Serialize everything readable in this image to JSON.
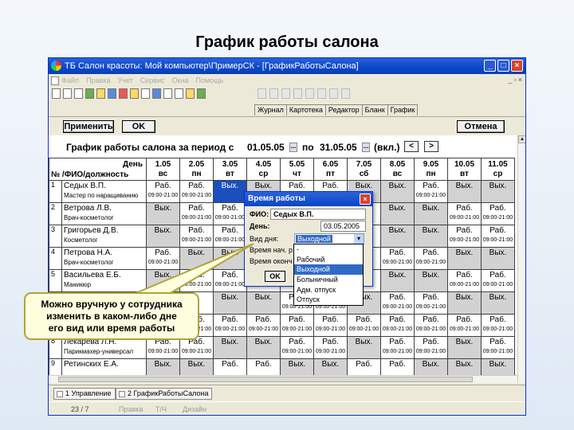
{
  "slide_title": "График работы салона",
  "window": {
    "title": "ТБ Салон красоты: Мой компьютер\\ПримерСК - [ГрафикРаботыСалона]",
    "min": "_",
    "max": "□",
    "close": "×"
  },
  "menu": [
    "Файл",
    "Правка",
    "Учет",
    "Сервис",
    "Окна",
    "Помощь"
  ],
  "tabs": [
    "Журнал",
    "Картотека",
    "Редактор",
    "Бланк",
    "График"
  ],
  "buttons": {
    "apply": "Применить",
    "ok": "OK",
    "cancel": "Отмена"
  },
  "period": {
    "label": "График работы салона за период с",
    "from": "01.05.05",
    "to_label": "по",
    "to": "31.05.05",
    "incl": "(вкл.)",
    "pick": "...",
    "prev": "<",
    "next": ">"
  },
  "grid_header": {
    "day_label": "День",
    "name_label": "№ /ФИО/должность"
  },
  "days": [
    {
      "d": "1.05",
      "w": "вс"
    },
    {
      "d": "2.05",
      "w": "пн"
    },
    {
      "d": "3.05",
      "w": "вт"
    },
    {
      "d": "4.05",
      "w": "ср"
    },
    {
      "d": "5.05",
      "w": "чт"
    },
    {
      "d": "6.05",
      "w": "пт"
    },
    {
      "d": "7.05",
      "w": "сб"
    },
    {
      "d": "8.05",
      "w": "вс"
    },
    {
      "d": "9.05",
      "w": "пн"
    },
    {
      "d": "10.05",
      "w": "вт"
    },
    {
      "d": "11.05",
      "w": "ср"
    }
  ],
  "employees": [
    {
      "n": "1",
      "name": "Седых В.П.",
      "pos": "Мастер по наращиванию",
      "cells": [
        {
          "s": "Раб.",
          "t": "09:00-21:00"
        },
        {
          "s": "Раб.",
          "t": "09:00-21:00"
        },
        {
          "s": "Вых.",
          "sel": true
        },
        {
          "s": "Вых."
        },
        {
          "s": "Раб."
        },
        {
          "s": "Раб."
        },
        {
          "s": "Вых."
        },
        {
          "s": "Вых."
        },
        {
          "s": "Раб.",
          "t": "09:00-21:00"
        },
        {
          "s": "Вых."
        },
        {
          "s": "Вых."
        }
      ]
    },
    {
      "n": "2",
      "name": "Ветрова Л.В.",
      "pos": "Врач-косметолог",
      "cells": [
        {
          "s": "Вых."
        },
        {
          "s": "Раб.",
          "t": "09:00-21:00"
        },
        {
          "s": "Раб.",
          "t": "09:00-21:00"
        },
        {
          "s": ""
        },
        {
          "s": ""
        },
        {
          "s": ""
        },
        {
          "s": ""
        },
        {
          "s": "Вых."
        },
        {
          "s": "Вых."
        },
        {
          "s": "Раб.",
          "t": "09:00-21:00"
        },
        {
          "s": "Раб.",
          "t": "09:00-21:00"
        }
      ]
    },
    {
      "n": "3",
      "name": "Григорьев Д.В.",
      "pos": "Косметолог",
      "cells": [
        {
          "s": "Вых."
        },
        {
          "s": "Раб.",
          "t": "09:00-21:00"
        },
        {
          "s": "Раб.",
          "t": "09:00-21:00"
        },
        {
          "s": ""
        },
        {
          "s": ""
        },
        {
          "s": ""
        },
        {
          "s": ""
        },
        {
          "s": "Вых."
        },
        {
          "s": "Вых."
        },
        {
          "s": "Раб.",
          "t": "09:00-21:00"
        },
        {
          "s": "Раб.",
          "t": "09:00-21:00"
        }
      ]
    },
    {
      "n": "4",
      "name": "Петрова Н.А.",
      "pos": "Врач-косметолог",
      "cells": [
        {
          "s": "Раб.",
          "t": "09:00-21:00"
        },
        {
          "s": "Вых."
        },
        {
          "s": "Вых."
        },
        {
          "s": ""
        },
        {
          "s": ""
        },
        {
          "s": ""
        },
        {
          "s": ""
        },
        {
          "s": "Раб.",
          "t": "09:00-21:00"
        },
        {
          "s": "Раб.",
          "t": "09:00-21:00"
        },
        {
          "s": "Вых."
        },
        {
          "s": "Вых."
        }
      ]
    },
    {
      "n": "5",
      "name": "Васильева Е.Б.",
      "pos": "Маникюр",
      "cells": [
        {
          "s": "Вых."
        },
        {
          "s": "Раб.",
          "t": "09:00-21:00"
        },
        {
          "s": "Раб.",
          "t": "09:00-21:00"
        },
        {
          "s": ""
        },
        {
          "s": ""
        },
        {
          "s": ""
        },
        {
          "s": ""
        },
        {
          "s": "Вых."
        },
        {
          "s": "Вых."
        },
        {
          "s": "Раб.",
          "t": "09:00-21:00"
        },
        {
          "s": "Раб.",
          "t": "09:00-21:00"
        }
      ]
    },
    {
      "n": "6",
      "name": "",
      "pos": "",
      "cells": [
        {
          "s": ""
        },
        {
          "s": ""
        },
        {
          "s": "Вых."
        },
        {
          "s": "Вых."
        },
        {
          "s": "Раб.",
          "t": "09:00-21:00"
        },
        {
          "s": "Раб.",
          "t": "09:00-21:00"
        },
        {
          "s": "Вых."
        },
        {
          "s": "Раб.",
          "t": "09:00-21:00"
        },
        {
          "s": "Раб.",
          "t": "09:00-21:00"
        },
        {
          "s": "Вых."
        },
        {
          "s": "Вых."
        }
      ]
    },
    {
      "n": "7",
      "name": "",
      "pos": "",
      "cells": [
        {
          "s": ""
        },
        {
          "s": "Раб.",
          "t": "09:00-21:00"
        },
        {
          "s": "Раб.",
          "t": "09:00-21:00"
        },
        {
          "s": "Раб.",
          "t": "09:00-21:00"
        },
        {
          "s": "Раб.",
          "t": "09:00-21:00"
        },
        {
          "s": "Раб.",
          "t": "09:00-21:00"
        },
        {
          "s": "Раб.",
          "t": "09:00-21:00"
        },
        {
          "s": "Раб.",
          "t": "09:00-21:00"
        },
        {
          "s": "Раб.",
          "t": "09:00-21:00"
        },
        {
          "s": "Раб.",
          "t": "09:00-21:00"
        },
        {
          "s": "Раб.",
          "t": "09:00-21:00"
        }
      ]
    },
    {
      "n": "8",
      "name": "Лекарева Л.Н.",
      "pos": "Парикмахер-универсал",
      "cells": [
        {
          "s": "Раб.",
          "t": "09:00-21:00"
        },
        {
          "s": "Раб.",
          "t": "09:00-21:00"
        },
        {
          "s": "Вых."
        },
        {
          "s": "Вых."
        },
        {
          "s": "Раб.",
          "t": "09:00-21:00"
        },
        {
          "s": "Раб.",
          "t": "09:00-21:00"
        },
        {
          "s": "Вых."
        },
        {
          "s": "Раб.",
          "t": "09:00-21:00"
        },
        {
          "s": "Раб.",
          "t": "09:00-21:00"
        },
        {
          "s": "Вых."
        },
        {
          "s": "Раб.",
          "t": "09:00-21:00"
        }
      ]
    },
    {
      "n": "9",
      "name": "Ретинских Е.А.",
      "pos": "",
      "cells": [
        {
          "s": "Вых."
        },
        {
          "s": "Вых."
        },
        {
          "s": "Раб."
        },
        {
          "s": "Раб."
        },
        {
          "s": "Вых."
        },
        {
          "s": "Вых."
        },
        {
          "s": "Раб."
        },
        {
          "s": "Раб."
        },
        {
          "s": "Вых."
        },
        {
          "s": "Вых."
        },
        {
          "s": "Вых."
        }
      ]
    }
  ],
  "dialog": {
    "title": "Время работы",
    "close": "×",
    "fio_label": "ФИО:",
    "fio": "Седых В.П.",
    "day_label": "День:",
    "day": "03.05.2005",
    "type_label": "Вид дня:",
    "type_value": "Выходной",
    "dropdown_arrow": "▾",
    "time_label": "Время нач. р",
    "end_label": "Время оконч",
    "ok": "OK",
    "options": [
      "-",
      "Рабочий",
      "Выходной",
      "Больничный",
      "Адм. отпуск",
      "Отпуск"
    ]
  },
  "callout": {
    "line1": "Можно вручную у сотрудника",
    "line2": "изменить в каком-либо дне",
    "line3": "его вид или время работы"
  },
  "taskbar": [
    "1 Управление",
    "2 ГрафикРаботыСалона"
  ],
  "status": {
    "pages": "23 / 7",
    "edit": "Правка",
    "tch": "Т/Ч",
    "design": "Дизайн"
  },
  "colors": {
    "title_bar": "#0a46c8",
    "selected_cell": "#1b4fbd",
    "day_off": "#d2d2d2",
    "callout_bg": "#ffffe0",
    "callout_border": "#b0a33a"
  }
}
